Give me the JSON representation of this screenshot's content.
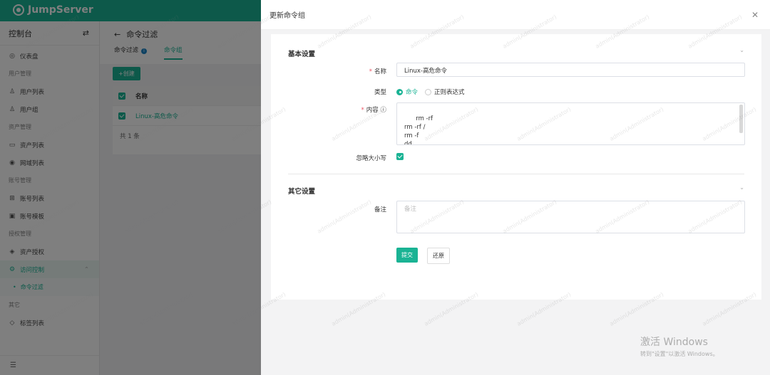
{
  "app": {
    "brand": "JumpServer",
    "console_label": "控制台"
  },
  "sidebar": {
    "items": [
      {
        "label": "仪表盘",
        "type": "item"
      },
      {
        "label": "用户管理",
        "type": "section"
      },
      {
        "label": "用户列表",
        "type": "item"
      },
      {
        "label": "用户组",
        "type": "item"
      },
      {
        "label": "资产管理",
        "type": "section"
      },
      {
        "label": "资产列表",
        "type": "item"
      },
      {
        "label": "网域列表",
        "type": "item"
      },
      {
        "label": "账号管理",
        "type": "section"
      },
      {
        "label": "账号列表",
        "type": "item"
      },
      {
        "label": "账号模板",
        "type": "item"
      },
      {
        "label": "授权管理",
        "type": "section"
      },
      {
        "label": "资产授权",
        "type": "item"
      },
      {
        "label": "访问控制",
        "type": "group"
      },
      {
        "label": "命令过滤",
        "type": "subitem"
      },
      {
        "label": "其它",
        "type": "section"
      },
      {
        "label": "标签列表",
        "type": "item"
      }
    ]
  },
  "main": {
    "back_label": "←",
    "title": "命令过滤",
    "tabs": [
      {
        "label": "命令过滤"
      },
      {
        "label": "命令组"
      }
    ],
    "create_label": "+创建",
    "table": {
      "name_header": "名称",
      "rows": [
        {
          "name": "Linux-高危命令"
        }
      ],
      "total": "共 1 条"
    }
  },
  "drawer": {
    "title": "更新命令组",
    "basic_section": "基本设置",
    "name_label": "名称",
    "name_value": "Linux-高危命令",
    "type_label": "类型",
    "type_options": [
      {
        "label": "命令",
        "selected": true
      },
      {
        "label": "正则表达式",
        "selected": false
      }
    ],
    "content_label": "内容",
    "content_value": "rm -rf\nrm -rf /\nrm -f\ndd",
    "ignore_case_label": "忽略大小写",
    "other_section": "其它设置",
    "remark_label": "备注",
    "remark_placeholder": "备注",
    "submit_label": "提交",
    "reset_label": "还原"
  },
  "watermark": {
    "text": "admin(Administrator)"
  },
  "windows": {
    "line1": "激活 Windows",
    "line2": "转到\"设置\"以激活 Windows。"
  },
  "colors": {
    "primary": "#1ab394",
    "sidebar_bg": "#ffffff",
    "overlay": "rgba(0,0,0,0.5)",
    "required": "#ed5565"
  }
}
